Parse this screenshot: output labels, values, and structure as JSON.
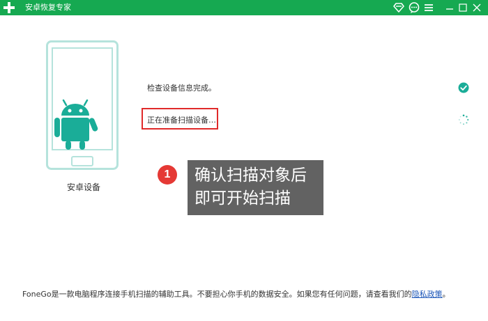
{
  "app": {
    "title": "安卓恢复专家",
    "logo_icon": "medical-plus-logo",
    "brand_color": "#16a951"
  },
  "window_controls": {
    "icons": [
      "wifi-diamond-icon",
      "chat-icon",
      "menu-icon",
      "minimize-icon",
      "maximize-icon",
      "close-icon"
    ]
  },
  "device": {
    "label": "安卓设备",
    "icon": "android-phone-illustration"
  },
  "steps": [
    {
      "text": "检查设备信息完成。",
      "status": "done",
      "icon": "check-icon"
    },
    {
      "text": "正在准备扫描设备…",
      "status": "loading",
      "icon": "spinner-icon"
    }
  ],
  "annotation": {
    "badge": "1",
    "line1": "确认扫描对象后",
    "line2": "即可开始扫描"
  },
  "footer": {
    "text": "FoneGo是一款电脑程序连接手机扫描的辅助工具。不要担心你手机的数据安全。如果您有任何问题，请查看我们的",
    "link": "隐私政策",
    "suffix": "。"
  },
  "colors": {
    "accent_green": "#16a951",
    "highlight_red": "#e02a2a",
    "badge_red": "#e53935",
    "tooltip_bg": "#626262",
    "link_blue": "#1a55b8"
  }
}
